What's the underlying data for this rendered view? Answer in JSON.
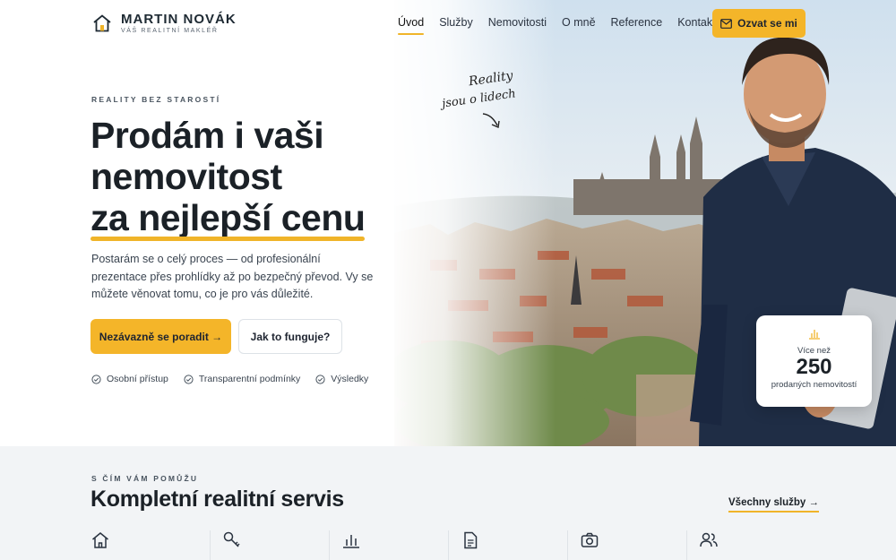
{
  "brand": {
    "name": "MARTIN NOVÁK",
    "tagline": "VÁŠ REALITNÍ MAKLÉŘ",
    "icon": "house-icon"
  },
  "nav": {
    "items": [
      {
        "label": "Úvod",
        "active": true
      },
      {
        "label": "Služby",
        "active": false
      },
      {
        "label": "Nemovitosti",
        "active": false
      },
      {
        "label": "O mně",
        "active": false
      },
      {
        "label": "Reference",
        "active": false
      },
      {
        "label": "Kontakt",
        "active": false
      }
    ],
    "contact_button": {
      "label": "Ozvat se mi",
      "icon": "mail-icon"
    }
  },
  "hero": {
    "eyebrow": "REALITY BEZ STAROSTÍ",
    "title_line1": "Prodám i vaši",
    "title_line2": "nemovitost",
    "title_highlight": "za nejlepší cenu",
    "description": "Postarám se o celý proces — od profesionální prezentace přes prohlídky až po bezpečný převod. Vy se můžete věnovat tomu, co je pro vás důležité.",
    "primary_button": "Nezávazně se poradit →",
    "secondary_button": "Jak to funguje?",
    "checks": [
      "Osobní přístup",
      "Transparentní podmínky",
      "Výsledky"
    ],
    "handnote_line1": "Reality",
    "handnote_line2": "jsou o lidech",
    "stat": {
      "pre": "Více než",
      "value": "250",
      "post": "prodaných nemovitostí",
      "icon": "chart-icon"
    }
  },
  "services": {
    "eyebrow": "S ČÍM VÁM POMŮŽU",
    "title": "Kompletní realitní servis",
    "all_link": "Všechny služby →",
    "icons": [
      "house-icon",
      "key-icon",
      "chart-icon",
      "document-icon",
      "camera-icon",
      "users-icon"
    ]
  },
  "colors": {
    "accent": "#f4b529",
    "text": "#1b2127",
    "section_bg": "#f2f4f6"
  }
}
